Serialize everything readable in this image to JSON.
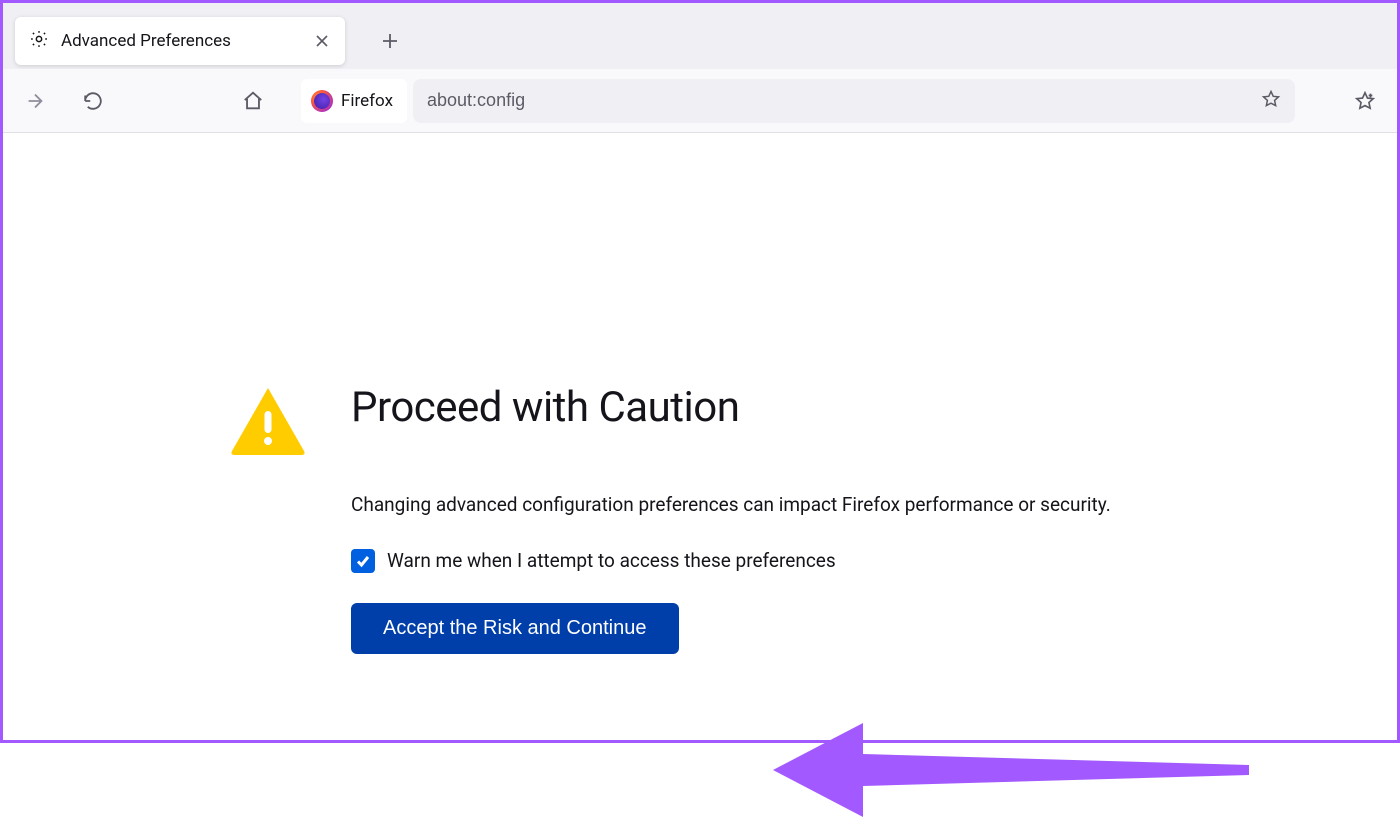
{
  "tab": {
    "title": "Advanced Preferences"
  },
  "toolbar": {
    "identity_label": "Firefox",
    "url": "about:config"
  },
  "warning": {
    "title": "Proceed with Caution",
    "description": "Changing advanced configuration preferences can impact Firefox performance or security.",
    "checkbox_label": "Warn me when I attempt to access these preferences",
    "checkbox_checked": true,
    "button_label": "Accept the Risk and Continue"
  },
  "colors": {
    "accent_blue": "#003eaa",
    "checkbox_blue": "#0060df",
    "warn_yellow": "#ffcc00",
    "annotation_purple": "#a259ff"
  }
}
